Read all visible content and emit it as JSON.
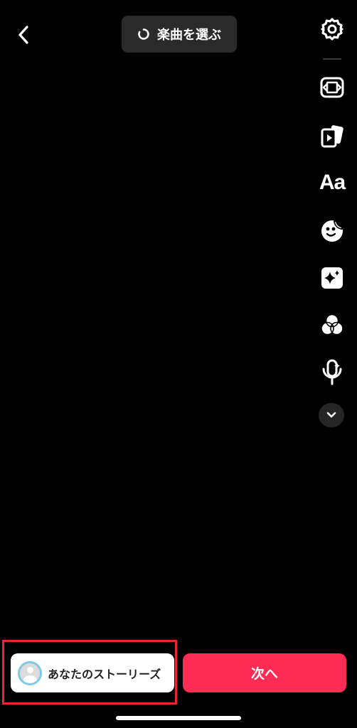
{
  "header": {
    "back_icon": "chevron-left-icon",
    "music_icon": "refresh-circle-icon",
    "music_label": "楽曲を選ぶ"
  },
  "toolbar": {
    "items": [
      {
        "name": "settings",
        "icon": "gear-icon"
      },
      {
        "name": "flip-frame",
        "icon": "frame-flip-icon"
      },
      {
        "name": "templates",
        "icon": "cards-play-icon"
      },
      {
        "name": "text",
        "icon": "text-icon",
        "label": "Aa"
      },
      {
        "name": "stickers",
        "icon": "sticker-icon"
      },
      {
        "name": "effects",
        "icon": "sparkle-box-icon"
      },
      {
        "name": "filters",
        "icon": "filter-circles-icon"
      },
      {
        "name": "voice",
        "icon": "voice-effect-mic-icon"
      },
      {
        "name": "more",
        "icon": "chevron-down-icon"
      }
    ]
  },
  "bottom": {
    "story_label": "あなたのストーリーズ",
    "next_label": "次へ"
  },
  "colors": {
    "background": "#000000",
    "pill": "#2a2a2a",
    "next": "#fe2c55",
    "highlight": "#e8262f",
    "avatar_ring": "#7fc9e6"
  }
}
